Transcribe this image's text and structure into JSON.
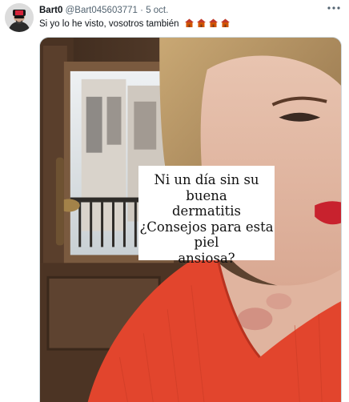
{
  "tweet": {
    "author_name": "Bart0",
    "handle": "@Bart045603771",
    "separator": "·",
    "date": "5 oct.",
    "text": "Si yo lo he visto, vosotros también",
    "emoji_icons": [
      "house-emoji-icon",
      "house-emoji-icon",
      "house-emoji-icon",
      "house-emoji-icon"
    ],
    "more_icon": "more-options-icon",
    "media": {
      "overlay_caption_lines": [
        "Ni un día sin su buena",
        "dermatitis",
        "¿Consejos para esta piel",
        "ansiosa?"
      ]
    }
  },
  "colors": {
    "text_primary": "#0f1419",
    "text_secondary": "#536471",
    "border": "#cfd9de",
    "shirt_red": "#e2452d"
  }
}
